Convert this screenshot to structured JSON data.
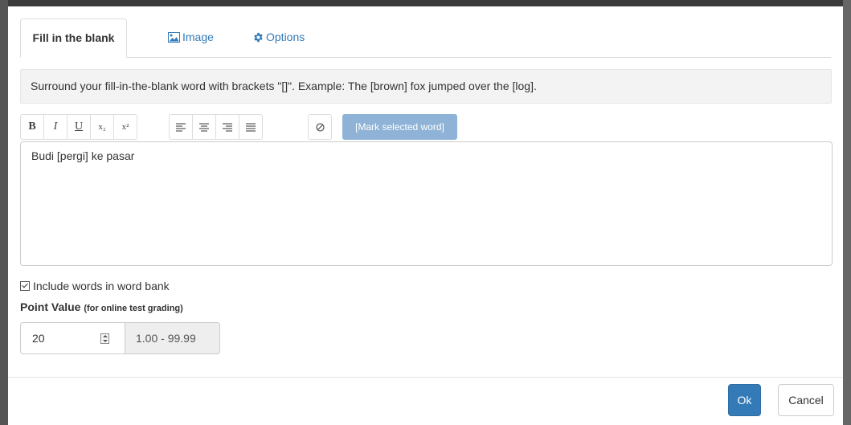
{
  "tabs": [
    {
      "label": "Fill in the blank",
      "icon": null,
      "active": true
    },
    {
      "label": "Image",
      "icon": "image-icon",
      "active": false
    },
    {
      "label": "Options",
      "icon": "gear-icon",
      "active": false
    }
  ],
  "instruction": "Surround your fill-in-the-blank word with brackets \"[]\". Example: The [brown] fox jumped over the [log].",
  "toolbar": {
    "bold": "B",
    "italic": "I",
    "underline": "U",
    "subscript": "x₂",
    "superscript": "x²",
    "mark_label": "[Mark selected word]"
  },
  "editor": {
    "content": "Budi [pergi] ke pasar"
  },
  "word_bank": {
    "label": "Include words in word bank",
    "checked": true
  },
  "point_value": {
    "label": "Point Value",
    "sublabel": "(for online test grading)",
    "value": "20",
    "range": "1.00 - 99.99"
  },
  "footer": {
    "ok_label": "Ok",
    "cancel_label": "Cancel"
  },
  "colors": {
    "primary": "#337ab7",
    "mark_button": "#8fb3d6",
    "instruction_bg": "#f3f3f3"
  }
}
